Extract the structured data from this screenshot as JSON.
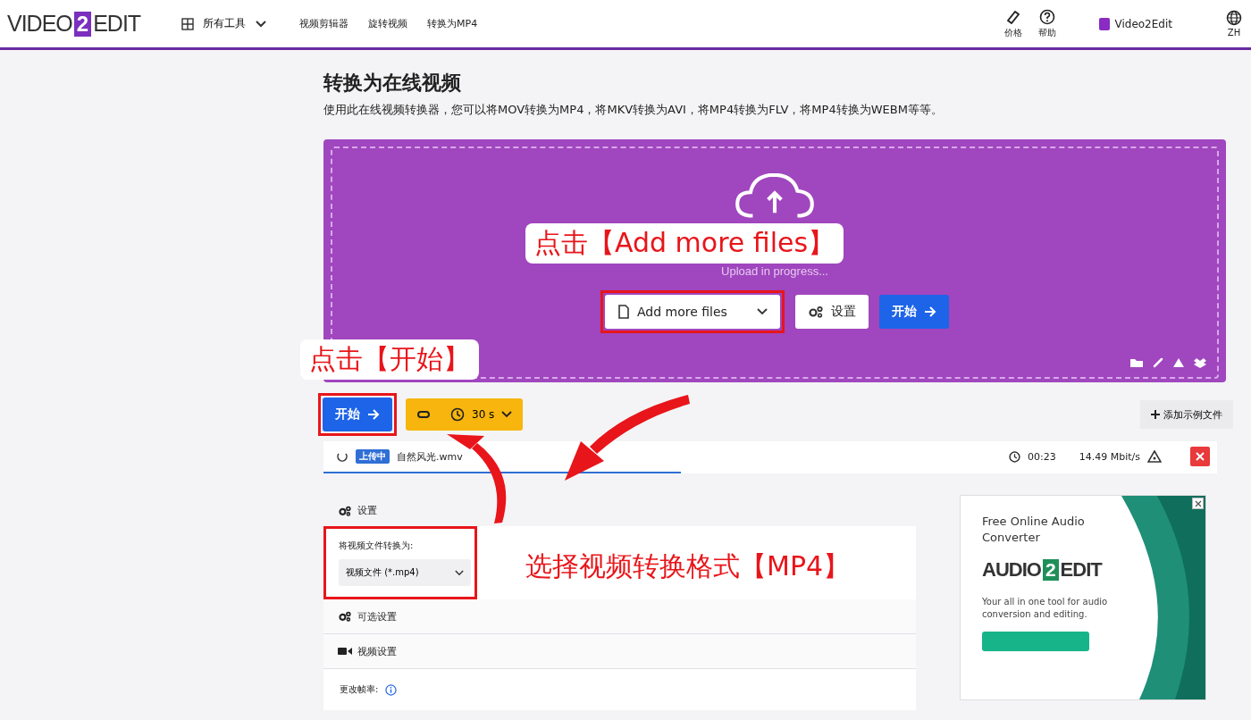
{
  "header": {
    "logo": {
      "left": "VIDEO",
      "mark": "2",
      "right": "EDIT"
    },
    "menu": "所有工具",
    "nav": [
      "视频剪辑器",
      "旋转视频",
      "转换为MP4"
    ],
    "actions": [
      {
        "kind": "tag",
        "label": "价格"
      },
      {
        "kind": "help",
        "label": "帮助"
      }
    ],
    "account": "Video2Edit",
    "language": "ZH"
  },
  "page": {
    "title": "转换为在线视频",
    "description": "使用此在线视频转换器，您可以将MOV转换为MP4，将MKV转换为AVI，将MP4转换为FLV，将MP4转换为WEBM等等。"
  },
  "upload": {
    "status": "Upload in progress...",
    "buttons": [
      {
        "kind": "dropdown",
        "label": "Add more files",
        "highlighted": true
      },
      {
        "kind": "settings",
        "label": "设置",
        "highlighted": false
      },
      {
        "kind": "primary",
        "label": "开始",
        "highlighted": false
      }
    ]
  },
  "toolbar": {
    "start": "开始",
    "start_highlighted": true,
    "timer": "30 s",
    "add_sample": "添加示例文件"
  },
  "file": {
    "status": "上传中",
    "name": "自然风光.wmv",
    "time": "00:23",
    "speed": "14.49 Mbit/s",
    "level": 0.4
  },
  "settings": {
    "heading": "设置",
    "convert_label": "将视频文件转换为:",
    "format": "视频文件 (*.mp4)",
    "format_highlighted": true,
    "sections": [
      {
        "kind": "gears",
        "label": "可选设置"
      },
      {
        "kind": "video",
        "label": "视频设置"
      }
    ],
    "field_label": "更改帧率:"
  },
  "ad": {
    "headline": "Free Online Audio Converter",
    "logo": {
      "left": "AUDIO",
      "mark": "2",
      "right": "EDIT"
    },
    "text": "Your all in one tool for audio conversion and editing."
  },
  "annotations": [
    "点击【Add more files】",
    "点击【开始】",
    "选择视频转换格式【MP4】"
  ]
}
